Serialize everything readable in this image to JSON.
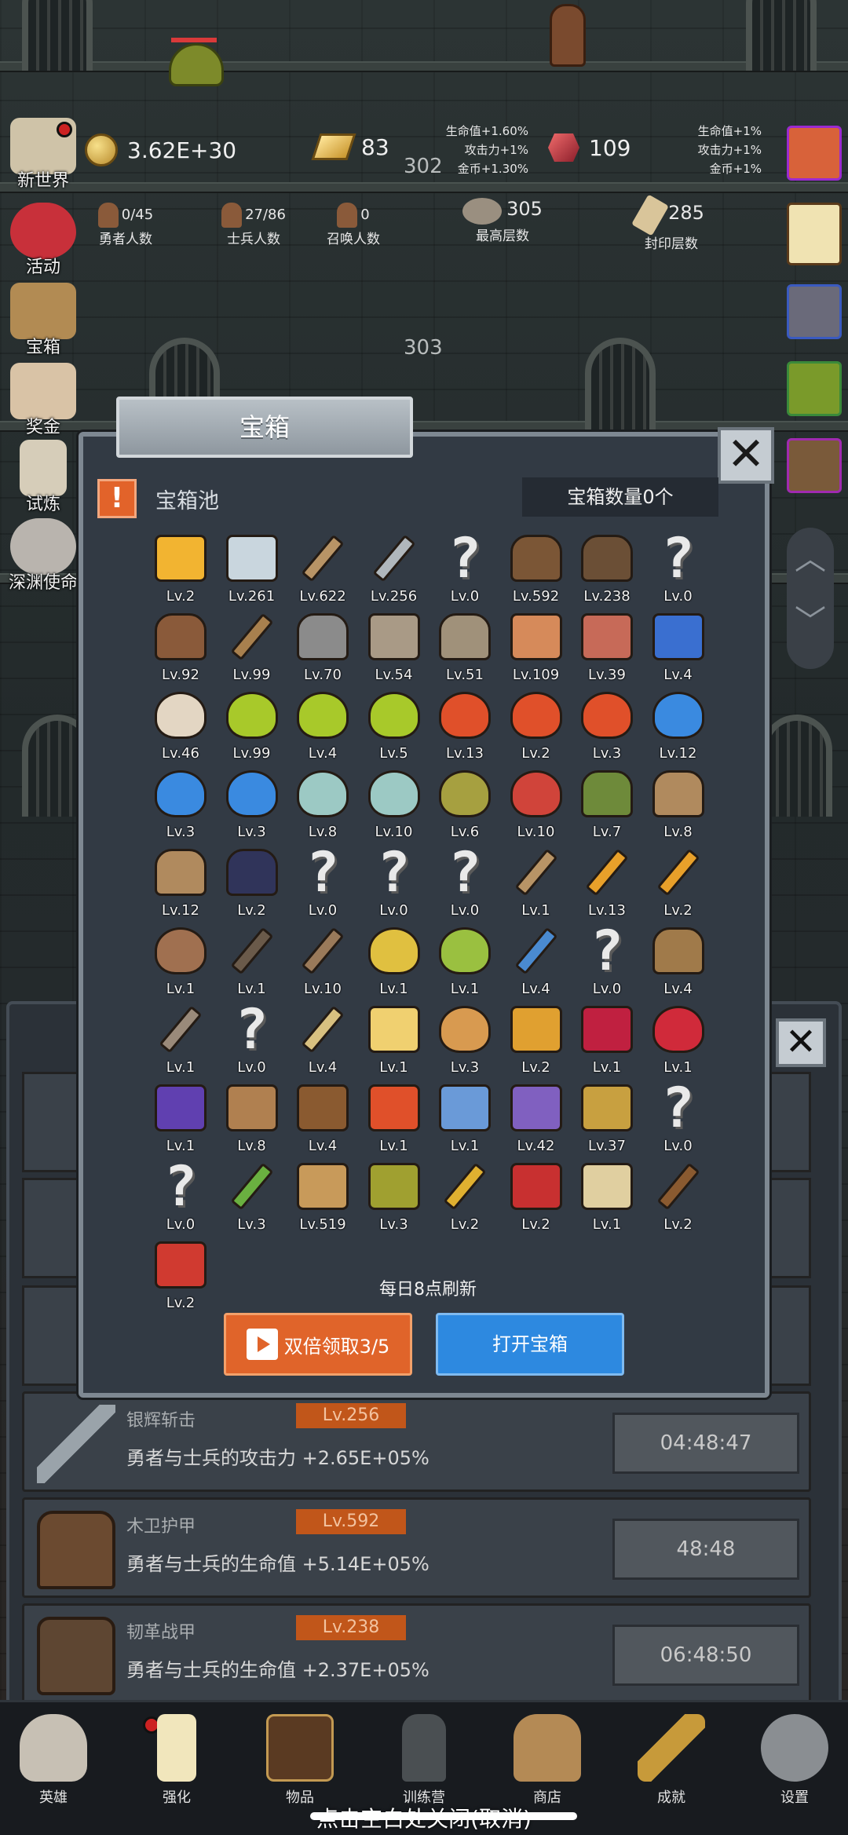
{
  "top": {
    "coins": "3.62E+30",
    "gold": "83",
    "floor_current": "302",
    "gem": "109",
    "buff_left": [
      "生命值+1.60%",
      "攻击力+1%",
      "金币+1.30%"
    ],
    "buff_right": [
      "生命值+1%",
      "攻击力+1%",
      "金币+1%"
    ],
    "heroes_value": "0/45",
    "heroes_label": "勇者人数",
    "soldiers_value": "27/86",
    "soldiers_label": "士兵人数",
    "summons_value": "0",
    "summons_label": "召唤人数",
    "max_floor_value": "305",
    "max_floor_label": "最高层数",
    "sealed_floor_value": "285",
    "sealed_floor_label": "封印层数",
    "floor_next": "303"
  },
  "left_menu": [
    {
      "label": "新世界",
      "icon": "map-icon"
    },
    {
      "label": "活动",
      "icon": "heart-icon"
    },
    {
      "label": "宝箱",
      "icon": "chest-icon"
    },
    {
      "label": "奖金",
      "icon": "envelope-icon"
    },
    {
      "label": "试炼",
      "icon": "feather-icon"
    },
    {
      "label": "深渊使命",
      "icon": "skull-icon"
    }
  ],
  "dialog": {
    "title": "宝箱",
    "pool_title": "宝箱池",
    "count": "宝箱数量0个",
    "refresh": "每日8点刷新",
    "double_btn": "双倍领取3/5",
    "open_btn": "打开宝箱",
    "items": [
      {
        "icon": "crown-icon",
        "lv": "Lv.2"
      },
      {
        "icon": "diamond-icon",
        "lv": "Lv.261"
      },
      {
        "icon": "sword-icon",
        "lv": "Lv.622"
      },
      {
        "icon": "silver-sword-icon",
        "lv": "Lv.256"
      },
      {
        "icon": "unknown-icon",
        "lv": "Lv.0"
      },
      {
        "icon": "wood-armor-icon",
        "lv": "Lv.592"
      },
      {
        "icon": "leather-armor-icon",
        "lv": "Lv.238"
      },
      {
        "icon": "unknown-icon",
        "lv": "Lv.0"
      },
      {
        "icon": "leather-helmet-icon",
        "lv": "Lv.92"
      },
      {
        "icon": "wooden-sword-icon",
        "lv": "Lv.99"
      },
      {
        "icon": "iron-helmet-icon",
        "lv": "Lv.70"
      },
      {
        "icon": "hammer-icon",
        "lv": "Lv.54"
      },
      {
        "icon": "knight-helmet-icon",
        "lv": "Lv.51"
      },
      {
        "icon": "ham-icon",
        "lv": "Lv.109"
      },
      {
        "icon": "steak-icon",
        "lv": "Lv.39"
      },
      {
        "icon": "pouch-icon",
        "lv": "Lv.4"
      },
      {
        "icon": "bread-icon",
        "lv": "Lv.46"
      },
      {
        "icon": "green-potion-icon",
        "lv": "Lv.99"
      },
      {
        "icon": "green-potion-icon",
        "lv": "Lv.4"
      },
      {
        "icon": "green-potion-icon",
        "lv": "Lv.5"
      },
      {
        "icon": "red-potion-icon",
        "lv": "Lv.13"
      },
      {
        "icon": "red-potion-icon",
        "lv": "Lv.2"
      },
      {
        "icon": "red-potion-icon",
        "lv": "Lv.3"
      },
      {
        "icon": "blue-potion-icon",
        "lv": "Lv.12"
      },
      {
        "icon": "blue-potion-icon",
        "lv": "Lv.3"
      },
      {
        "icon": "blue-potion-icon",
        "lv": "Lv.3"
      },
      {
        "icon": "teal-bottle-icon",
        "lv": "Lv.8"
      },
      {
        "icon": "teal-bottle-icon",
        "lv": "Lv.10"
      },
      {
        "icon": "olive-bottle-icon",
        "lv": "Lv.6"
      },
      {
        "icon": "red-bottle-icon",
        "lv": "Lv.10"
      },
      {
        "icon": "winged-boot-icon",
        "lv": "Lv.7"
      },
      {
        "icon": "boot-icon",
        "lv": "Lv.8"
      },
      {
        "icon": "boot-icon",
        "lv": "Lv.12"
      },
      {
        "icon": "purple-boot-icon",
        "lv": "Lv.2"
      },
      {
        "icon": "unknown-icon",
        "lv": "Lv.0"
      },
      {
        "icon": "unknown-icon",
        "lv": "Lv.0"
      },
      {
        "icon": "unknown-icon",
        "lv": "Lv.0"
      },
      {
        "icon": "sword-icon",
        "lv": "Lv.1"
      },
      {
        "icon": "torch-icon",
        "lv": "Lv.13"
      },
      {
        "icon": "torch-icon",
        "lv": "Lv.2"
      },
      {
        "icon": "mushroom-icon",
        "lv": "Lv.1"
      },
      {
        "icon": "pickaxe-icon",
        "lv": "Lv.1"
      },
      {
        "icon": "staff-icon",
        "lv": "Lv.10"
      },
      {
        "icon": "lemon-icon",
        "lv": "Lv.1"
      },
      {
        "icon": "lime-icon",
        "lv": "Lv.1"
      },
      {
        "icon": "wand-icon",
        "lv": "Lv.4"
      },
      {
        "icon": "unknown-icon",
        "lv": "Lv.0"
      },
      {
        "icon": "backpack-icon",
        "lv": "Lv.4"
      },
      {
        "icon": "shovel-icon",
        "lv": "Lv.1"
      },
      {
        "icon": "unknown-icon",
        "lv": "Lv.0"
      },
      {
        "icon": "broom-icon",
        "lv": "Lv.4"
      },
      {
        "icon": "cheese-icon",
        "lv": "Lv.1"
      },
      {
        "icon": "pie-icon",
        "lv": "Lv.3"
      },
      {
        "icon": "honey-jar-icon",
        "lv": "Lv.2"
      },
      {
        "icon": "red-crystal-icon",
        "lv": "Lv.1"
      },
      {
        "icon": "red-orb-icon",
        "lv": "Lv.1"
      },
      {
        "icon": "rune-cube-icon",
        "lv": "Lv.1"
      },
      {
        "icon": "bow-icon",
        "lv": "Lv.8"
      },
      {
        "icon": "quiver-icon",
        "lv": "Lv.4"
      },
      {
        "icon": "golden-shield-icon",
        "lv": "Lv.1"
      },
      {
        "icon": "blue-amulet-icon",
        "lv": "Lv.1"
      },
      {
        "icon": "purple-amulet-icon",
        "lv": "Lv.42"
      },
      {
        "icon": "emblem-icon",
        "lv": "Lv.37"
      },
      {
        "icon": "unknown-icon",
        "lv": "Lv.0"
      },
      {
        "icon": "unknown-icon",
        "lv": "Lv.0"
      },
      {
        "icon": "green-wand-icon",
        "lv": "Lv.3"
      },
      {
        "icon": "beer-mug-icon",
        "lv": "Lv.519"
      },
      {
        "icon": "vine-icon",
        "lv": "Lv.3"
      },
      {
        "icon": "golden-pickaxe-icon",
        "lv": "Lv.2"
      },
      {
        "icon": "red-book-icon",
        "lv": "Lv.2"
      },
      {
        "icon": "scroll-icon",
        "lv": "Lv.1"
      },
      {
        "icon": "whip-icon",
        "lv": "Lv.2"
      },
      {
        "icon": "red-card-icon",
        "lv": "Lv.2"
      }
    ]
  },
  "list": [
    {
      "name": "银辉斩击",
      "lv": "Lv.256",
      "desc": "勇者与士兵的攻击力 +2.65E+05%",
      "timer": "04:48:47",
      "icon": "silver-sword-icon"
    },
    {
      "name": "木卫护甲",
      "lv": "Lv.592",
      "desc": "勇者与士兵的生命值 +5.14E+05%",
      "timer": "48:48",
      "icon": "wood-armor-icon"
    },
    {
      "name": "韧革战甲",
      "lv": "Lv.238",
      "desc": "勇者与士兵的生命值 +2.37E+05%",
      "timer": "06:48:50",
      "icon": "leather-armor-icon"
    }
  ],
  "bottom_nav": [
    {
      "label": "英雄",
      "icon": "skull-icon"
    },
    {
      "label": "强化",
      "icon": "candle-icon"
    },
    {
      "label": "物品",
      "icon": "book-icon"
    },
    {
      "label": "训练营",
      "icon": "lantern-icon"
    },
    {
      "label": "商店",
      "icon": "beer-mug-icon"
    },
    {
      "label": "成就",
      "icon": "key-icon"
    },
    {
      "label": "设置",
      "icon": "gear-icon"
    }
  ],
  "hint": "点击空白处关闭(取消)",
  "colors": {
    "accent_orange": "#e0642a",
    "accent_blue": "#2d89e0",
    "panel": "#323a44",
    "level_badge": "#c1561a"
  }
}
